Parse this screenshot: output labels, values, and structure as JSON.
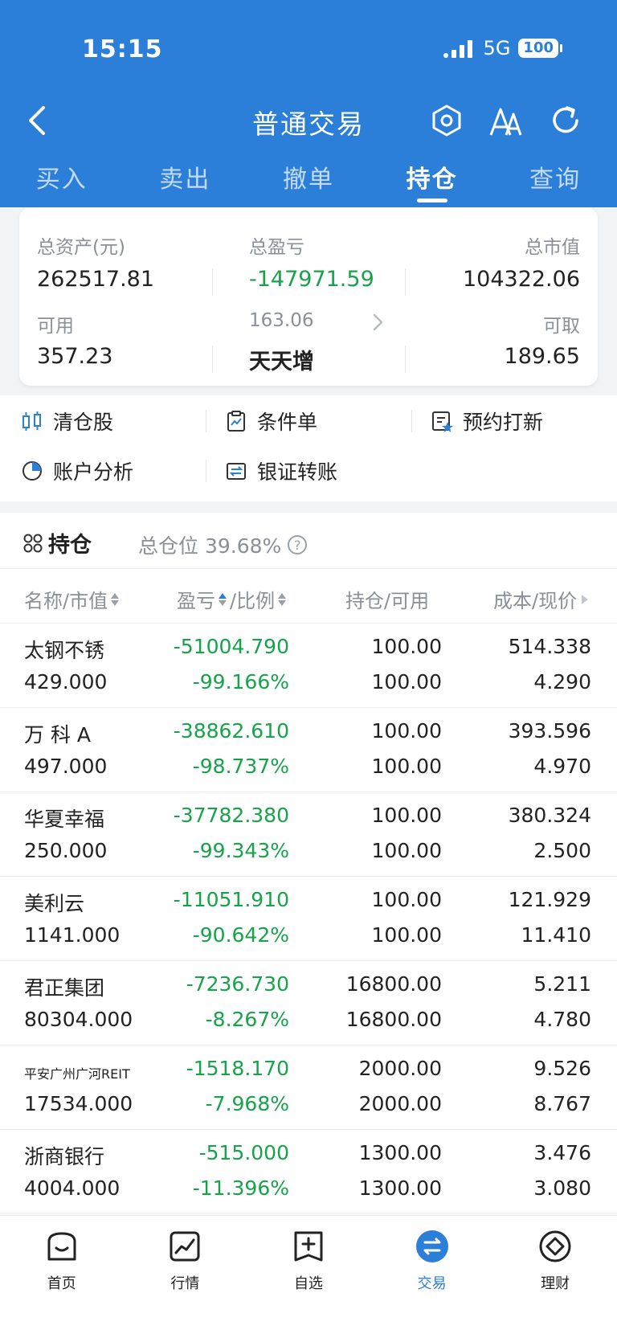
{
  "status_bar": {
    "time": "15:15",
    "network": "5G",
    "battery": "100"
  },
  "nav": {
    "title": "普通交易"
  },
  "tabs": [
    {
      "label": "买入",
      "active": false
    },
    {
      "label": "卖出",
      "active": false
    },
    {
      "label": "撤单",
      "active": false
    },
    {
      "label": "持仓",
      "active": true
    },
    {
      "label": "查询",
      "active": false
    }
  ],
  "summary": {
    "total_assets_label": "总资产(元)",
    "total_assets": "262517.81",
    "total_pl_label": "总盈亏",
    "total_pl": "-147971.59",
    "market_value_label": "总市值",
    "market_value": "104322.06",
    "available_label": "可用",
    "available": "357.23",
    "fund_amount": "163.06",
    "fund_name": "天天增",
    "withdrawable_label": "可取",
    "withdrawable": "189.65"
  },
  "quick_actions": [
    {
      "label": "清仓股",
      "icon": "clear-position-icon"
    },
    {
      "label": "条件单",
      "icon": "condition-order-icon"
    },
    {
      "label": "预约打新",
      "icon": "ipo-booking-icon"
    },
    {
      "label": "账户分析",
      "icon": "pie-chart-icon"
    },
    {
      "label": "银证转账",
      "icon": "transfer-icon"
    }
  ],
  "positions": {
    "title": "持仓",
    "ratio_label": "总仓位 39.68%",
    "columns": [
      "名称/市值",
      "盈亏",
      "/比例",
      "持仓/可用",
      "成本/现价"
    ],
    "rows": [
      {
        "name": "太钢不锈",
        "market_value": "429.000",
        "pl": "-51004.790",
        "pl_ratio": "-99.166%",
        "qty": "100.00",
        "avail": "100.00",
        "cost": "514.338",
        "price": "4.290"
      },
      {
        "name": "万 科 A",
        "market_value": "497.000",
        "pl": "-38862.610",
        "pl_ratio": "-98.737%",
        "qty": "100.00",
        "avail": "100.00",
        "cost": "393.596",
        "price": "4.970"
      },
      {
        "name": "华夏幸福",
        "market_value": "250.000",
        "pl": "-37782.380",
        "pl_ratio": "-99.343%",
        "qty": "100.00",
        "avail": "100.00",
        "cost": "380.324",
        "price": "2.500"
      },
      {
        "name": "美利云",
        "market_value": "1141.000",
        "pl": "-11051.910",
        "pl_ratio": "-90.642%",
        "qty": "100.00",
        "avail": "100.00",
        "cost": "121.929",
        "price": "11.410"
      },
      {
        "name": "君正集团",
        "market_value": "80304.000",
        "pl": "-7236.730",
        "pl_ratio": "-8.267%",
        "qty": "16800.00",
        "avail": "16800.00",
        "cost": "5.211",
        "price": "4.780"
      },
      {
        "name": "平安广州广河REIT",
        "market_value": "17534.000",
        "pl": "-1518.170",
        "pl_ratio": "-7.968%",
        "qty": "2000.00",
        "avail": "2000.00",
        "cost": "9.526",
        "price": "8.767"
      },
      {
        "name": "浙商银行",
        "market_value": "4004.000",
        "pl": "-515.000",
        "pl_ratio": "-11.396%",
        "qty": "1300.00",
        "avail": "1300.00",
        "cost": "3.476",
        "price": "3.080"
      }
    ]
  },
  "tabbar": [
    {
      "label": "首页",
      "icon": "home-icon",
      "active": false
    },
    {
      "label": "行情",
      "icon": "market-chart-icon",
      "active": false
    },
    {
      "label": "自选",
      "icon": "watchlist-add-icon",
      "active": false
    },
    {
      "label": "交易",
      "icon": "trade-exchange-icon",
      "active": true
    },
    {
      "label": "理财",
      "icon": "wealth-icon",
      "active": false
    }
  ],
  "colors": {
    "brand_blue": "#2c7fd9",
    "loss_green": "#16a34a"
  }
}
